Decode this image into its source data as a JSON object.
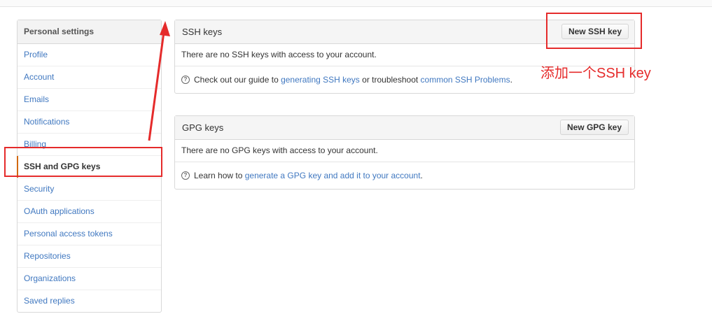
{
  "sidebar": {
    "header": "Personal settings",
    "items": [
      {
        "label": "Profile"
      },
      {
        "label": "Account"
      },
      {
        "label": "Emails"
      },
      {
        "label": "Notifications"
      },
      {
        "label": "Billing"
      },
      {
        "label": "SSH and GPG keys",
        "selected": true
      },
      {
        "label": "Security"
      },
      {
        "label": "OAuth applications"
      },
      {
        "label": "Personal access tokens"
      },
      {
        "label": "Repositories"
      },
      {
        "label": "Organizations"
      },
      {
        "label": "Saved replies"
      }
    ]
  },
  "ssh": {
    "title": "SSH keys",
    "button_label": "New SSH key",
    "empty_text": "There are no SSH keys with access to your account.",
    "help_prefix": "Check out our guide to ",
    "help_link1": "generating SSH keys",
    "help_middle": " or troubleshoot ",
    "help_link2": "common SSH Problems",
    "help_suffix": "."
  },
  "gpg": {
    "title": "GPG keys",
    "button_label": "New GPG key",
    "empty_text": "There are no GPG keys with access to your account.",
    "help_prefix": "Learn how to ",
    "help_link": "generate a GPG key and add it to your account",
    "help_suffix": "."
  },
  "annotation": {
    "text": "添加一个SSH key",
    "color": "#e52b2b"
  },
  "colors": {
    "link": "#4078c0",
    "selected_accent": "#d26911"
  },
  "icons": {
    "help": "question-circle-icon",
    "arrow": "red-arrow-annotation"
  }
}
